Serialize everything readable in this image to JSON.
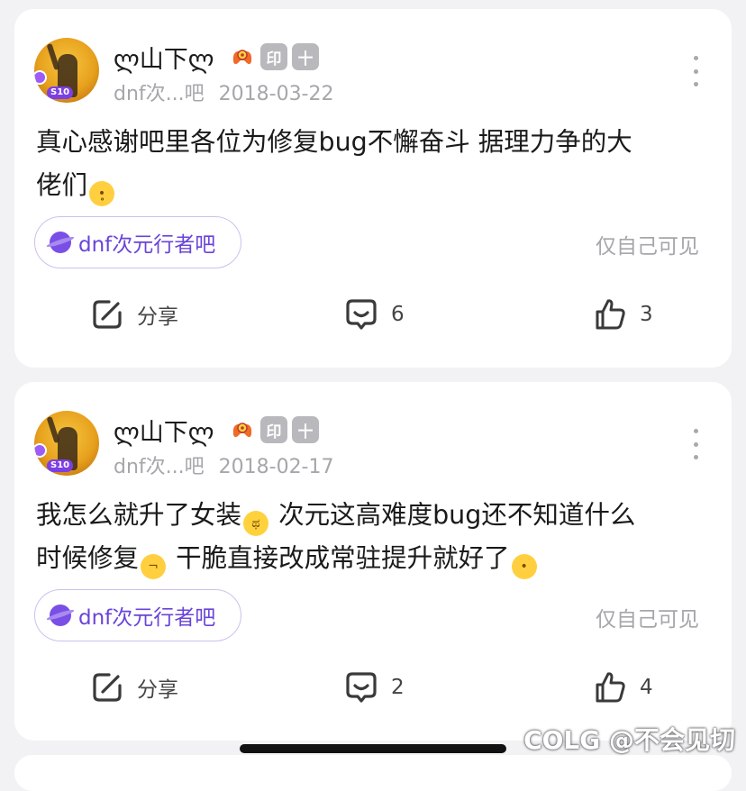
{
  "posts": [
    {
      "username": "ლ山下ლ",
      "avatar_badge": "S10",
      "forum_short": "dnf次...吧",
      "date": "2018-03-22",
      "content_line1": "真心感谢吧里各位为修复bug不懈奋斗 据理力争的大",
      "content_line2": "佬们",
      "forum_tag": "dnf次元行者吧",
      "visibility": "仅自己可见",
      "share_label": "分享",
      "comment_count": "6",
      "like_count": "3"
    },
    {
      "username": "ლ山下ლ",
      "avatar_badge": "S10",
      "forum_short": "dnf次...吧",
      "date": "2018-02-17",
      "content_line1a": "我怎么就升了女装",
      "content_line1b": " 次元这高难度bug还不知道什么",
      "content_line2a": "时候修复",
      "content_line2b": " 干脆直接改成常驻提升就好了",
      "forum_tag": "dnf次元行者吧",
      "visibility": "仅自己可见",
      "share_label": "分享",
      "comment_count": "2",
      "like_count": "4"
    }
  ],
  "user_badges": {
    "print": "印",
    "plus": "十"
  },
  "icons": {
    "share": "share-edit-icon",
    "comment": "comment-bubble-icon",
    "like": "thumbs-up-icon",
    "more": "more-vertical-icon",
    "forum": "planet-icon"
  },
  "colors": {
    "accent": "#6a44d8",
    "tag_border": "#cdc0ee",
    "muted": "#a6a6ab"
  },
  "watermark": "COLG @不会见切"
}
